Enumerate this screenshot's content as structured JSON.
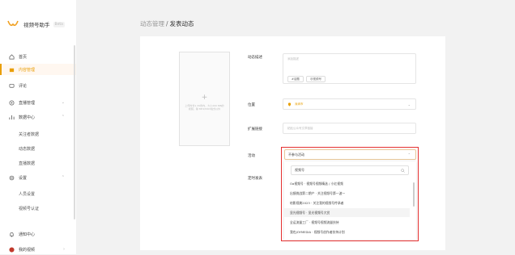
{
  "sidebar": {
    "logo_name": "视频号助手",
    "logo_badge": "Beta",
    "items": [
      {
        "label": "首页",
        "icon": "home-icon"
      },
      {
        "label": "内容管理",
        "icon": "content-icon"
      },
      {
        "label": "评论",
        "icon": "comment-icon"
      },
      {
        "label": "直播管理",
        "icon": "live-icon"
      },
      {
        "label": "数据中心",
        "icon": "data-icon"
      },
      {
        "label": "设置",
        "icon": "settings-icon"
      }
    ],
    "data_sub": [
      "关注者数据",
      "动态数据",
      "直播数据"
    ],
    "settings_sub": [
      "人员设置",
      "视频号认证"
    ],
    "bottom": [
      {
        "label": "通知中心",
        "icon": "bell-icon"
      },
      {
        "label": "我的视频",
        "icon": "avatar-icon"
      }
    ]
  },
  "breadcrumb": {
    "parent": "动态管理",
    "sep": "/",
    "current": "发表动态"
  },
  "upload": {
    "plus": "+",
    "hint": "上传时长1-30秒内，大小200 MB的视频，除 MP4/MOV格式以外"
  },
  "form": {
    "desc_label": "动态描述",
    "desc_placeholder": "添加描述",
    "tag_topic": "#话题",
    "tag_mention": "@视频号",
    "loc_label": "位置",
    "loc_value": "深圳市",
    "link_label": "扩展链接",
    "link_placeholder": "粘贴公众号文章链接",
    "activity_label": "活动",
    "activity_value": "不参与活动",
    "time_label": "定时发表"
  },
  "dropdown": {
    "search_value": "视频号",
    "items": [
      "Oa视频号 · 视频号视频精选 / 小红视频",
      "出镜挑战第二期产 · 关注视频号第一波一",
      "给影视美2023 · 关注我的视频号传承者",
      "显光视频号 · 显光视频号大赏",
      "全运流量工厂 · 视频号视频流量扶持",
      "我也JOYMEDIA · 视频号创作者扶持计划"
    ]
  },
  "colors": {
    "accent": "#e89f00",
    "highlight": "#e53030"
  }
}
